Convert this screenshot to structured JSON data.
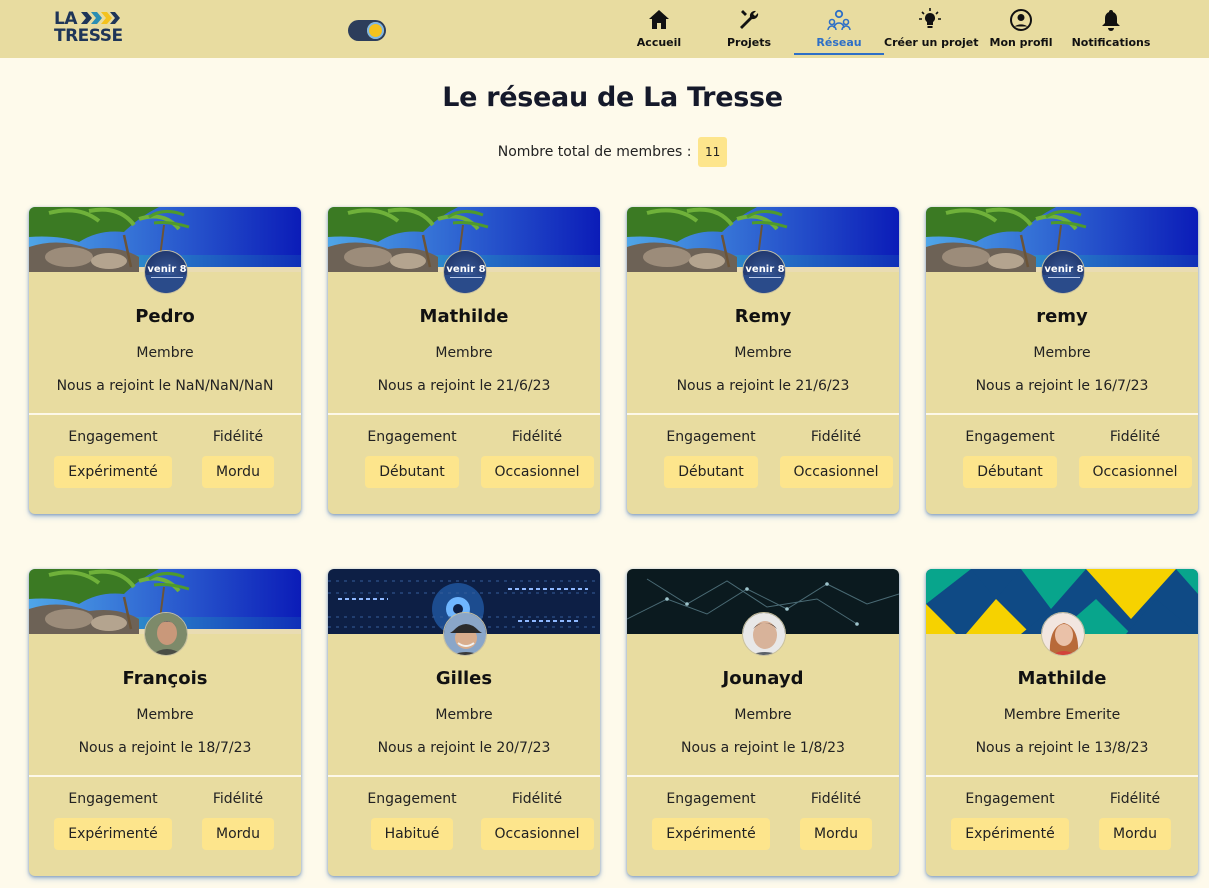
{
  "nav": {
    "logo_line1": "LA",
    "logo_line2": "TRESSE",
    "items": [
      {
        "label": "Accueil",
        "icon": "home-icon"
      },
      {
        "label": "Projets",
        "icon": "wrench-icon"
      },
      {
        "label": "Réseau",
        "icon": "network-icon",
        "active": true
      },
      {
        "label": "Créer un projet",
        "icon": "lightbulb-icon"
      },
      {
        "label": "Mon profil",
        "icon": "profile-icon"
      },
      {
        "label": "Notifications",
        "icon": "bell-icon"
      }
    ],
    "theme_toggle": "sun-icon"
  },
  "page": {
    "title": "Le réseau de La Tresse",
    "total_label": "Nombre total de membres :",
    "total_count": "11"
  },
  "labels": {
    "engagement": "Engagement",
    "fidelity": "Fidélité"
  },
  "members": [
    {
      "name": "Pedro",
      "role": "Membre",
      "joined": "Nous a rejoint le NaN/NaN/NaN",
      "engagement": "Expérimenté",
      "fidelity": "Mordu",
      "banner": "beach",
      "avatar": "venir8"
    },
    {
      "name": "Mathilde",
      "role": "Membre",
      "joined": "Nous a rejoint le 21/6/23",
      "engagement": "Débutant",
      "fidelity": "Occasionnel",
      "banner": "beach",
      "avatar": "venir8"
    },
    {
      "name": "Remy",
      "role": "Membre",
      "joined": "Nous a rejoint le 21/6/23",
      "engagement": "Débutant",
      "fidelity": "Occasionnel",
      "banner": "beach",
      "avatar": "venir8"
    },
    {
      "name": "remy",
      "role": "Membre",
      "joined": "Nous a rejoint le 16/7/23",
      "engagement": "Débutant",
      "fidelity": "Occasionnel",
      "banner": "beach",
      "avatar": "venir8"
    },
    {
      "name": "François",
      "role": "Membre",
      "joined": "Nous a rejoint le 18/7/23",
      "engagement": "Expérimenté",
      "fidelity": "Mordu",
      "banner": "beach",
      "avatar": "photo-man"
    },
    {
      "name": "Gilles",
      "role": "Membre",
      "joined": "Nous a rejoint le 20/7/23",
      "engagement": "Habitué",
      "fidelity": "Occasionnel",
      "banner": "tech",
      "avatar": "photo-cap"
    },
    {
      "name": "Jounayd",
      "role": "Membre",
      "joined": "Nous a rejoint le 1/8/23",
      "engagement": "Expérimenté",
      "fidelity": "Mordu",
      "banner": "network",
      "avatar": "photo-young"
    },
    {
      "name": "Mathilde",
      "role": "Membre Emerite",
      "joined": "Nous a rejoint le 13/8/23",
      "engagement": "Expérimenté",
      "fidelity": "Mordu",
      "banner": "triangles",
      "avatar": "photo-woman"
    }
  ],
  "avatar_text": "venir 8",
  "colors": {
    "nav_bg": "#e8dca0",
    "page_bg": "#fefaeb",
    "card_bg": "#e8dca0",
    "badge_bg": "#fde58c",
    "accent": "#2d6fc7"
  }
}
